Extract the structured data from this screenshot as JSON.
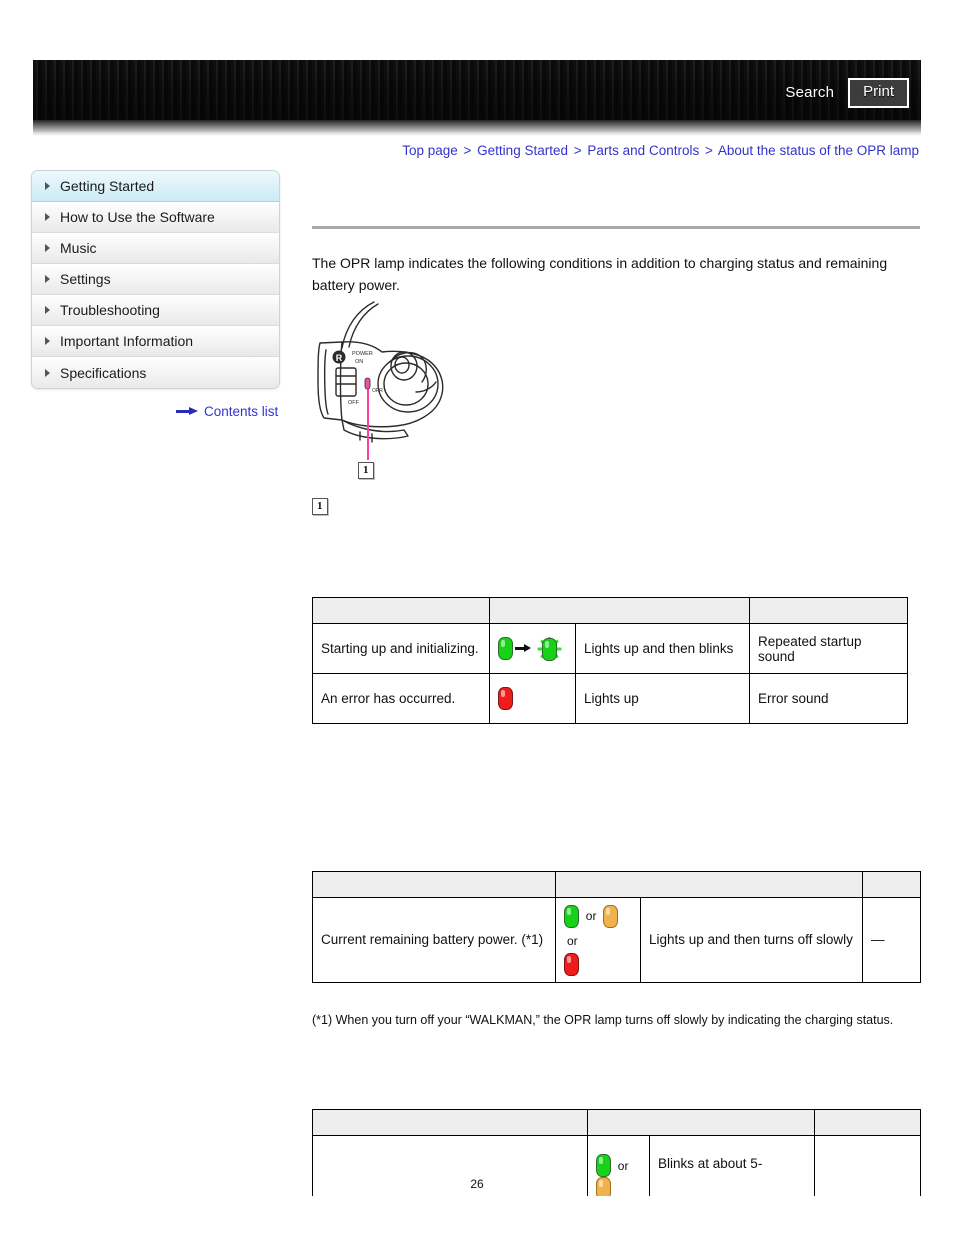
{
  "header": {
    "search_label": "Search",
    "print_label": "Print"
  },
  "breadcrumb": {
    "separator": ">",
    "items": [
      {
        "label": "Top page"
      },
      {
        "label": "Getting Started"
      },
      {
        "label": "Parts and Controls"
      },
      {
        "label": "About the status of the OPR lamp"
      }
    ]
  },
  "sidebar": {
    "items": [
      {
        "label": "Getting Started",
        "active": true
      },
      {
        "label": "How to Use the Software",
        "active": false
      },
      {
        "label": "Music",
        "active": false
      },
      {
        "label": "Settings",
        "active": false
      },
      {
        "label": "Troubleshooting",
        "active": false
      },
      {
        "label": "Important Information",
        "active": false
      },
      {
        "label": "Specifications",
        "active": false
      }
    ],
    "contents_link": "Contents list",
    "contents_icon": "right-arrow-icon"
  },
  "main": {
    "intro": "The OPR lamp indicates the following conditions in addition to charging status and remaining battery power.",
    "illustration": {
      "name": "walkman-right-earpiece-diagram",
      "callout_number": "1",
      "labels": [
        "R",
        "POWER",
        "ON",
        "OFF"
      ],
      "indicator_color": "#ff3ea5"
    },
    "callout_below_number": "1",
    "footnote": "(*1) When you turn off your “WALKMAN,” the OPR lamp turns off slowly by indicating the charging status.",
    "page_number": "26"
  },
  "tables": [
    {
      "id": "table1",
      "headers": [
        "",
        "",
        ""
      ],
      "rows": [
        {
          "condition": "Starting up and initializing.",
          "lamps": {
            "type": "transition",
            "from": "green",
            "to": "green-blink"
          },
          "behavior": "Lights up and then blinks",
          "sound": "Repeated startup sound"
        },
        {
          "condition": "An error has occurred.",
          "lamps": {
            "type": "single",
            "color": "red"
          },
          "behavior": "Lights up",
          "sound": "Error sound"
        }
      ]
    },
    {
      "id": "table2",
      "headers": [
        "",
        "",
        ""
      ],
      "rows": [
        {
          "condition": "Current remaining battery power. (*1)",
          "lamps": {
            "type": "or-three",
            "colors": [
              "green",
              "orange",
              "red"
            ],
            "or_label": "or"
          },
          "behavior": "Lights up and then turns off slowly",
          "sound": "—"
        }
      ]
    },
    {
      "id": "table3",
      "headers": [
        "",
        "",
        ""
      ],
      "rows": [
        {
          "condition": "",
          "lamps": {
            "type": "or-two",
            "colors": [
              "green",
              "orange"
            ],
            "or_label": "or"
          },
          "behavior": "Blinks at about 5-",
          "sound": ""
        }
      ]
    }
  ],
  "colors": {
    "link": "#3333cc",
    "lamp_green": "#17d317",
    "lamp_orange": "#f0b24a",
    "lamp_red": "#ef1c1c",
    "table_header_bg": "#eeeeee",
    "sidebar_active_bg": "#d9f1f8"
  }
}
